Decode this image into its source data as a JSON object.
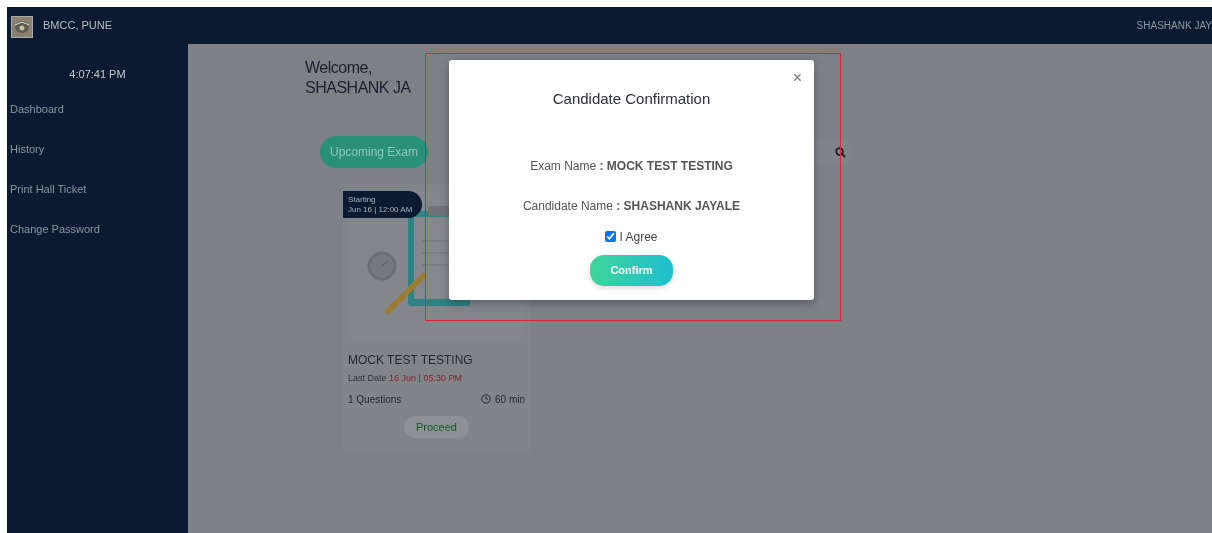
{
  "navbar": {
    "brand": "BMCC, PUNE",
    "user": "SHASHANK JAY"
  },
  "sidebar": {
    "clock": "4:07:41 PM",
    "items": [
      {
        "label": "Dashboard"
      },
      {
        "label": "History"
      },
      {
        "label": "Print Hall Ticket"
      },
      {
        "label": "Change Password"
      }
    ]
  },
  "main": {
    "welcome": [
      "Welcome,",
      "SHASHANK JA"
    ],
    "tab_button": "Upcoming Exam",
    "exams": [
      {
        "badge": [
          "Starting",
          "Jun 16 | 12:00 AM"
        ],
        "title": "MOCK TEST TESTING",
        "last_date_label": "Last Date",
        "last_date": "16 Jun | 05:30 PM",
        "questions": "1 Questions",
        "duration": "60 min",
        "action": "Proceed"
      }
    ]
  },
  "modal": {
    "title": "Candidate Confirmation",
    "close": "×",
    "lines": [
      "Exam Name **: MOCK TEST TESTING**",
      "Candidate Name **: SHASHANK JAYALE**"
    ],
    "agree": {
      "label": "I Agree",
      "checked": true
    },
    "confirm": "Confirm"
  }
}
